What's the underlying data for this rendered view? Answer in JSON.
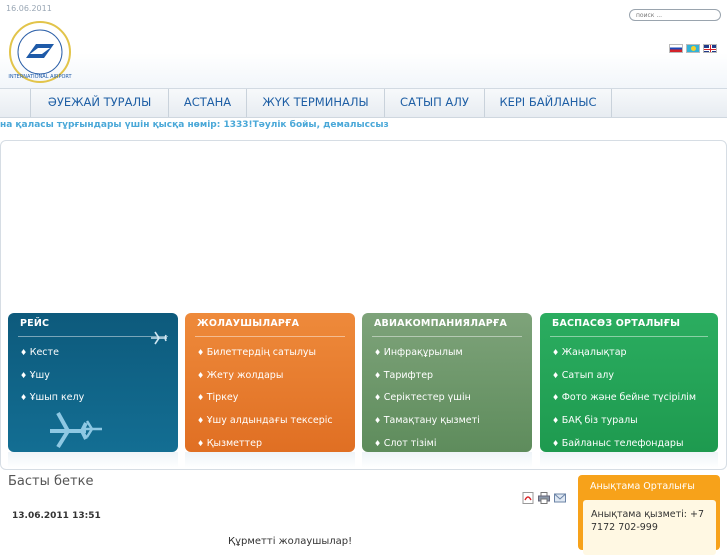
{
  "header": {
    "date": "16.06.2011",
    "search_placeholder": "поиск ...",
    "languages": [
      "ru-flag",
      "kz-flag",
      "en-flag"
    ]
  },
  "nav": {
    "items": [
      {
        "label": "ӘУЕЖАЙ ТУРАЛЫ"
      },
      {
        "label": "АСТАНА"
      },
      {
        "label": "ЖҮК ТЕРМИНАЛЫ"
      },
      {
        "label": "САТЫП АЛУ"
      },
      {
        "label": "КЕРІ БАЙЛАНЫС"
      }
    ]
  },
  "ticker": "на қаласы тұрғындары үшін қысқа нөмір: 1333!Тәулік бойы, демалыссыз",
  "tiles": [
    {
      "title": "РЕЙС",
      "color": "#0f5f82",
      "items": [
        "Кесте",
        "Ұшу",
        "Ұшып келу"
      ]
    },
    {
      "title": "ЖОЛАУШЫЛАРҒА",
      "color": "#ea7c2f",
      "items": [
        "Билеттердің сатылуы",
        "Жету жолдары",
        "Тіркеу",
        "Ұшу алдындағы тексеріс",
        "Қызметтер"
      ]
    },
    {
      "title": "АВИАКОМПАНИЯЛАРҒА",
      "color": "#6f9a6a",
      "items": [
        "Инфрақұрылым",
        "Тарифтер",
        "Серіктестер үшін",
        "Тамақтану қызметі",
        "Слот тізімі"
      ]
    },
    {
      "title": "БАСПАСӨЗ ОРТАЛЫҒЫ",
      "color": "#27a55a",
      "items": [
        "Жаңалықтар",
        "Сатып алу",
        "Фото және бейне түсірілім",
        "БАҚ біз туралы",
        "Байланыс телефондары"
      ]
    }
  ],
  "main": {
    "home_title": "Басты бетке",
    "datetime": "13.06.2011 13:51",
    "greeting": "Құрметті жолаушылар!"
  },
  "info": {
    "title": "Анықтама Орталығы",
    "text": "Анықтама қызметі: +7 7172 702-999"
  }
}
